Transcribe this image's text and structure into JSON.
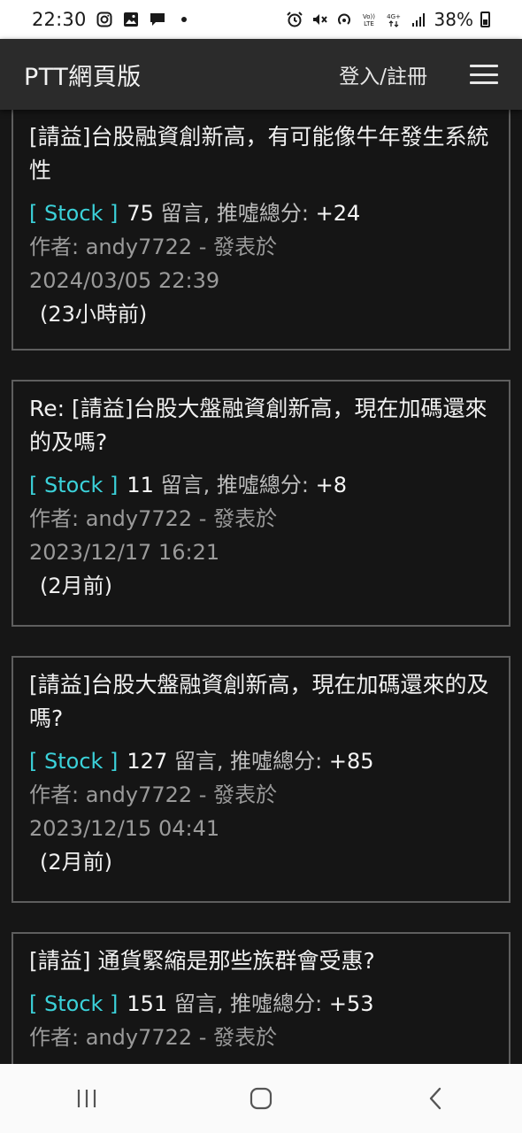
{
  "status": {
    "time": "22:30",
    "battery": "38%"
  },
  "header": {
    "brand": "PTT網頁版",
    "login": "登入/註冊"
  },
  "posts": [
    {
      "title": "[請益]台股融資創新高，有可能像牛年發生系統性",
      "board": "[ Stock ]",
      "comments": "75",
      "score_label": "留言, 推噓總分:",
      "score": "+24",
      "author": "作者: andy7722 - 發表於",
      "date": "2024/03/05 22:39",
      "ago": "(23小時前)"
    },
    {
      "title": "Re: [請益]台股大盤融資創新高，現在加碼還來的及嗎?",
      "board": "[ Stock ]",
      "comments": "11",
      "score_label": "留言, 推噓總分:",
      "score": "+8",
      "author": "作者: andy7722 - 發表於",
      "date": "2023/12/17 16:21",
      "ago": "(2月前)"
    },
    {
      "title": "[請益]台股大盤融資創新高，現在加碼還來的及嗎?",
      "board": "[ Stock ]",
      "comments": "127",
      "score_label": "留言, 推噓總分:",
      "score": "+85",
      "author": "作者: andy7722 - 發表於",
      "date": "2023/12/15 04:41",
      "ago": "(2月前)"
    },
    {
      "title": "[請益] 通貨緊縮是那些族群會受惠?",
      "board": "[ Stock ]",
      "comments": "151",
      "score_label": "留言, 推噓總分:",
      "score": "+53",
      "author": "作者: andy7722 - 發表於"
    }
  ]
}
